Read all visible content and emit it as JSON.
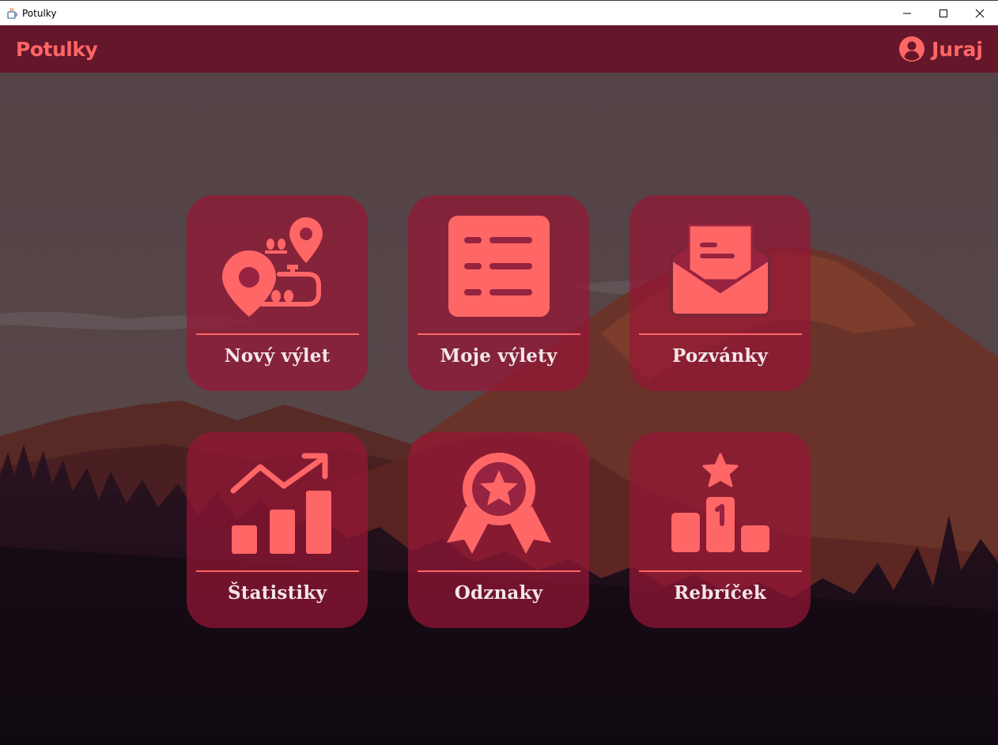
{
  "window": {
    "title": "Potulky"
  },
  "header": {
    "brand": "Potulky",
    "user_name": "Juraj"
  },
  "tiles": [
    {
      "label": "Nový výlet",
      "icon": "map-route-icon"
    },
    {
      "label": "Moje výlety",
      "icon": "list-icon"
    },
    {
      "label": "Pozvánky",
      "icon": "open-envelope-icon"
    },
    {
      "label": "Štatistiky",
      "icon": "growth-chart-icon"
    },
    {
      "label": "Odznaky",
      "icon": "badge-award-icon"
    },
    {
      "label": "Rebríček",
      "icon": "podium-icon"
    }
  ],
  "colors": {
    "accent": "#ff6666",
    "header_bg": "#65162b",
    "tile_bg": "#961636",
    "tile_label": "#f3e6e8"
  }
}
